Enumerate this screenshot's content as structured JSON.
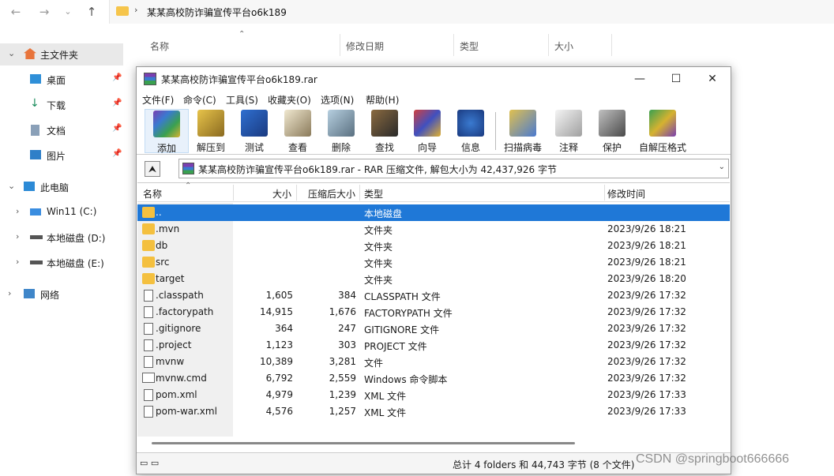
{
  "explorer": {
    "address_path": "某某高校防诈骗宣传平台o6k189",
    "columns": [
      "名称",
      "修改日期",
      "类型",
      "大小"
    ],
    "sidebar": [
      {
        "label": "主文件夹",
        "expand": "⌄",
        "icon": "home-icon"
      },
      {
        "label": "桌面",
        "icon": "desktop-icon"
      },
      {
        "label": "下载",
        "icon": "download-icon"
      },
      {
        "label": "文档",
        "icon": "document-icon"
      },
      {
        "label": "图片",
        "icon": "picture-icon"
      },
      {
        "label": "此电脑",
        "expand": "⌄",
        "icon": "computer-icon"
      },
      {
        "label": "Win11 (C:)",
        "expand": "›",
        "icon": "windows-drive-icon"
      },
      {
        "label": "本地磁盘 (D:)",
        "expand": "›",
        "icon": "drive-icon"
      },
      {
        "label": "本地磁盘 (E:)",
        "expand": "›",
        "icon": "drive-icon"
      },
      {
        "label": "网络",
        "expand": "›",
        "icon": "network-icon"
      }
    ]
  },
  "winrar": {
    "title": "某某高校防诈骗宣传平台o6k189.rar",
    "menu": [
      "文件(F)",
      "命令(C)",
      "工具(S)",
      "收藏夹(O)",
      "选项(N)",
      "帮助(H)"
    ],
    "toolbar": [
      "添加",
      "解压到",
      "测试",
      "查看",
      "删除",
      "查找",
      "向导",
      "信息",
      "扫描病毒",
      "注释",
      "保护",
      "自解压格式"
    ],
    "path_text": "某某高校防诈骗宣传平台o6k189.rar - RAR 压缩文件, 解包大小为 42,437,926 字节",
    "columns": [
      "名称",
      "大小",
      "压缩后大小",
      "类型",
      "修改时间"
    ],
    "rows": [
      {
        "name": "..",
        "size": "",
        "packed": "",
        "type": "本地磁盘",
        "modified": "",
        "kind": "folder"
      },
      {
        "name": ".mvn",
        "size": "",
        "packed": "",
        "type": "文件夹",
        "modified": "2023/9/26 18:21",
        "kind": "folder"
      },
      {
        "name": "db",
        "size": "",
        "packed": "",
        "type": "文件夹",
        "modified": "2023/9/26 18:21",
        "kind": "folder"
      },
      {
        "name": "src",
        "size": "",
        "packed": "",
        "type": "文件夹",
        "modified": "2023/9/26 18:21",
        "kind": "folder"
      },
      {
        "name": "target",
        "size": "",
        "packed": "",
        "type": "文件夹",
        "modified": "2023/9/26 18:20",
        "kind": "folder"
      },
      {
        "name": ".classpath",
        "size": "1,605",
        "packed": "384",
        "type": "CLASSPATH 文件",
        "modified": "2023/9/26 17:32",
        "kind": "file"
      },
      {
        "name": ".factorypath",
        "size": "14,915",
        "packed": "1,676",
        "type": "FACTORYPATH 文件",
        "modified": "2023/9/26 17:32",
        "kind": "file"
      },
      {
        "name": ".gitignore",
        "size": "364",
        "packed": "247",
        "type": "GITIGNORE 文件",
        "modified": "2023/9/26 17:32",
        "kind": "file"
      },
      {
        "name": ".project",
        "size": "1,123",
        "packed": "303",
        "type": "PROJECT 文件",
        "modified": "2023/9/26 17:32",
        "kind": "file"
      },
      {
        "name": "mvnw",
        "size": "10,389",
        "packed": "3,281",
        "type": "文件",
        "modified": "2023/9/26 17:32",
        "kind": "file"
      },
      {
        "name": "mvnw.cmd",
        "size": "6,792",
        "packed": "2,559",
        "type": "Windows 命令脚本",
        "modified": "2023/9/26 17:32",
        "kind": "cmd"
      },
      {
        "name": "pom.xml",
        "size": "4,979",
        "packed": "1,239",
        "type": "XML 文件",
        "modified": "2023/9/26 17:33",
        "kind": "file"
      },
      {
        "name": "pom-war.xml",
        "size": "4,576",
        "packed": "1,257",
        "type": "XML 文件",
        "modified": "2023/9/26 17:33",
        "kind": "file"
      }
    ],
    "status_text": "总计 4 folders 和 44,743 字节 (8 个文件)"
  },
  "watermark": "CSDN @springboot666666"
}
